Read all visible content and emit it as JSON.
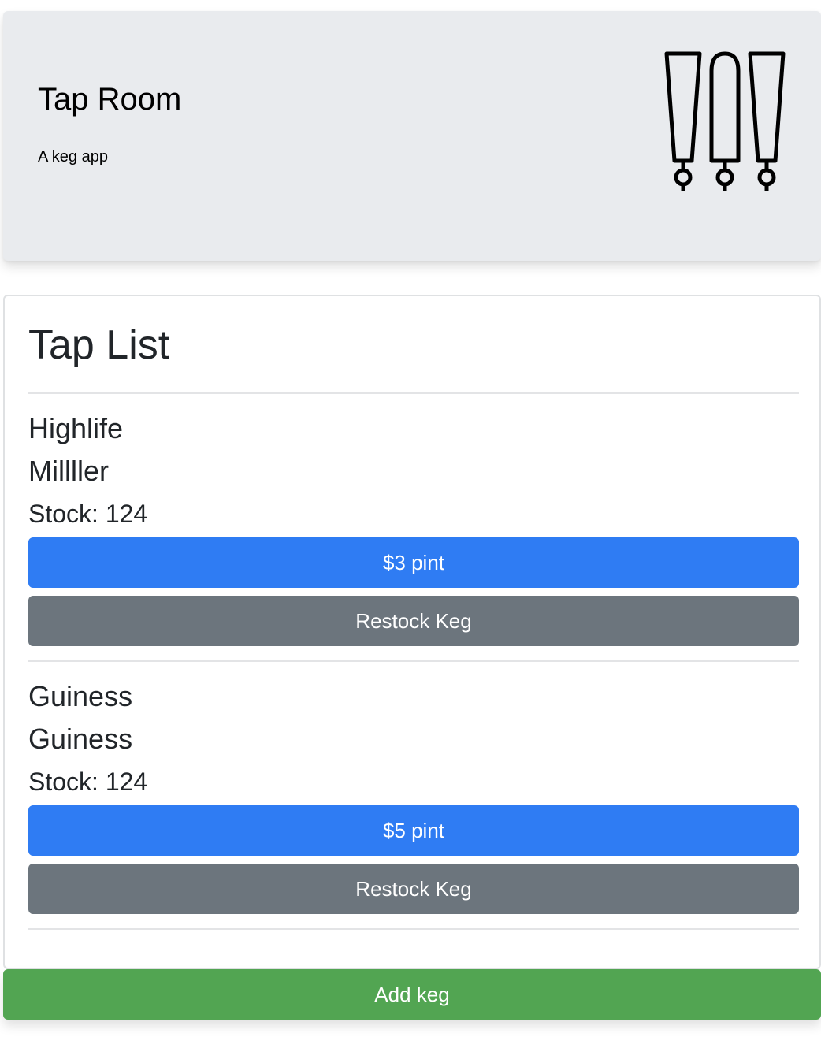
{
  "header": {
    "title": "Tap Room",
    "subtitle": "A keg app",
    "logo_icon": "beer-taps-icon",
    "background_color": "#e9ebee"
  },
  "tap_list": {
    "title": "Tap List",
    "kegs": [
      {
        "name": "Highlife",
        "brand": "Millller",
        "stock_label": "Stock: 124",
        "pint_button": "$3 pint",
        "restock_button": "Restock Keg"
      },
      {
        "name": "Guiness",
        "brand": "Guiness",
        "stock_label": "Stock: 124",
        "pint_button": "$5 pint",
        "restock_button": "Restock Keg"
      }
    ]
  },
  "add_keg_button": "Add keg",
  "colors": {
    "primary": "#2f7cf3",
    "secondary": "#6c757d",
    "success": "#52a552"
  }
}
